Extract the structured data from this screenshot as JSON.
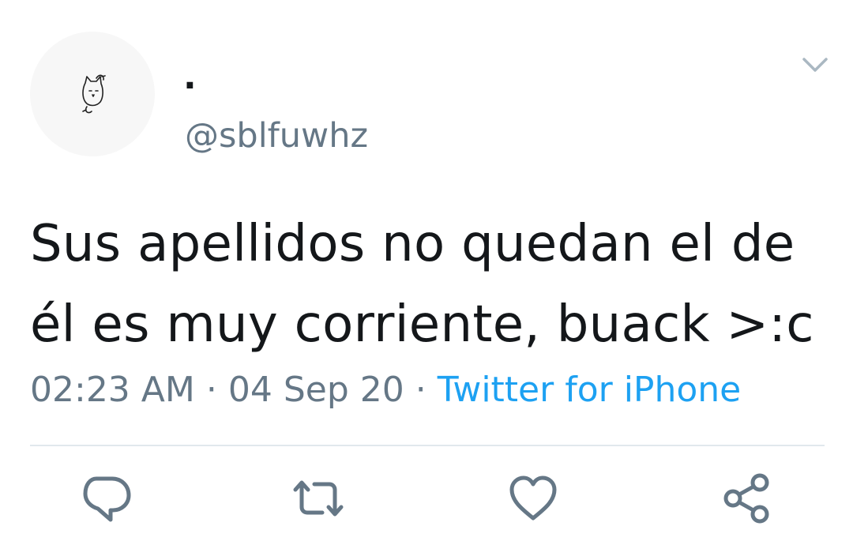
{
  "author": {
    "display_name": ".",
    "username": "@sblfuwhz"
  },
  "tweet": {
    "text": "Sus apellidos no quedan el de él es muy corriente, buack >:c",
    "time": "02:23 AM",
    "date": "04 Sep 20",
    "source": "Twitter for iPhone",
    "separator": "·"
  },
  "icons": {
    "avatar": "cat-doodle-icon",
    "menu": "chevron-down-icon",
    "reply": "reply-icon",
    "retweet": "retweet-icon",
    "like": "heart-icon",
    "share": "share-icon"
  },
  "colors": {
    "text_primary": "#14171a",
    "text_secondary": "#657786",
    "link": "#1da1f2",
    "icon": "#657786",
    "divider": "#e1e8ed",
    "avatar_bg": "#f7f7f7"
  }
}
